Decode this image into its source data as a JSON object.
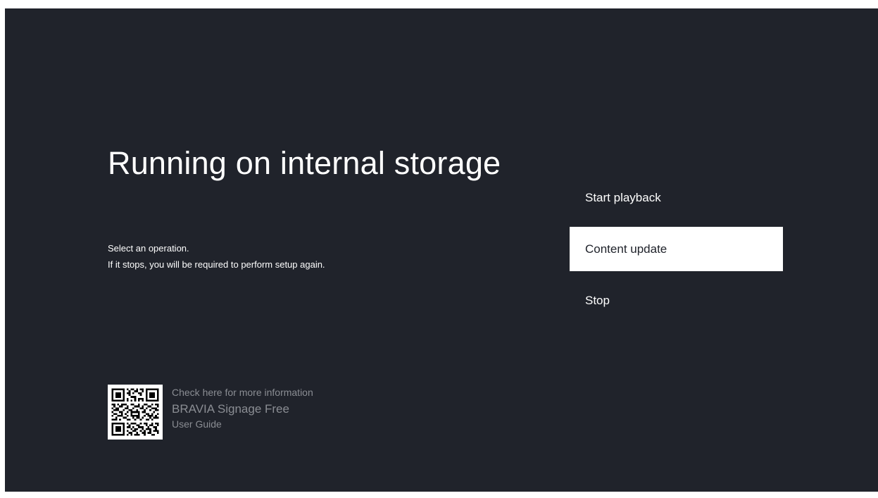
{
  "screen": {
    "title": "Running on internal storage",
    "description": {
      "line1": "Select an operation.",
      "line2": "If it stops, you will be required to perform setup again."
    }
  },
  "menu": {
    "items": [
      {
        "label": "Start playback",
        "focused": false
      },
      {
        "label": "Content update",
        "focused": true
      },
      {
        "label": "Stop",
        "focused": false
      }
    ]
  },
  "info": {
    "qr_icon": "qr-code-icon",
    "line1": "Check here for more information",
    "line2": "BRAVIA Signage Free",
    "line3": "User Guide"
  },
  "colors": {
    "background": "#20232b",
    "text": "#ffffff",
    "focus_background": "#ffffff",
    "muted_text": "#8a8d93"
  }
}
